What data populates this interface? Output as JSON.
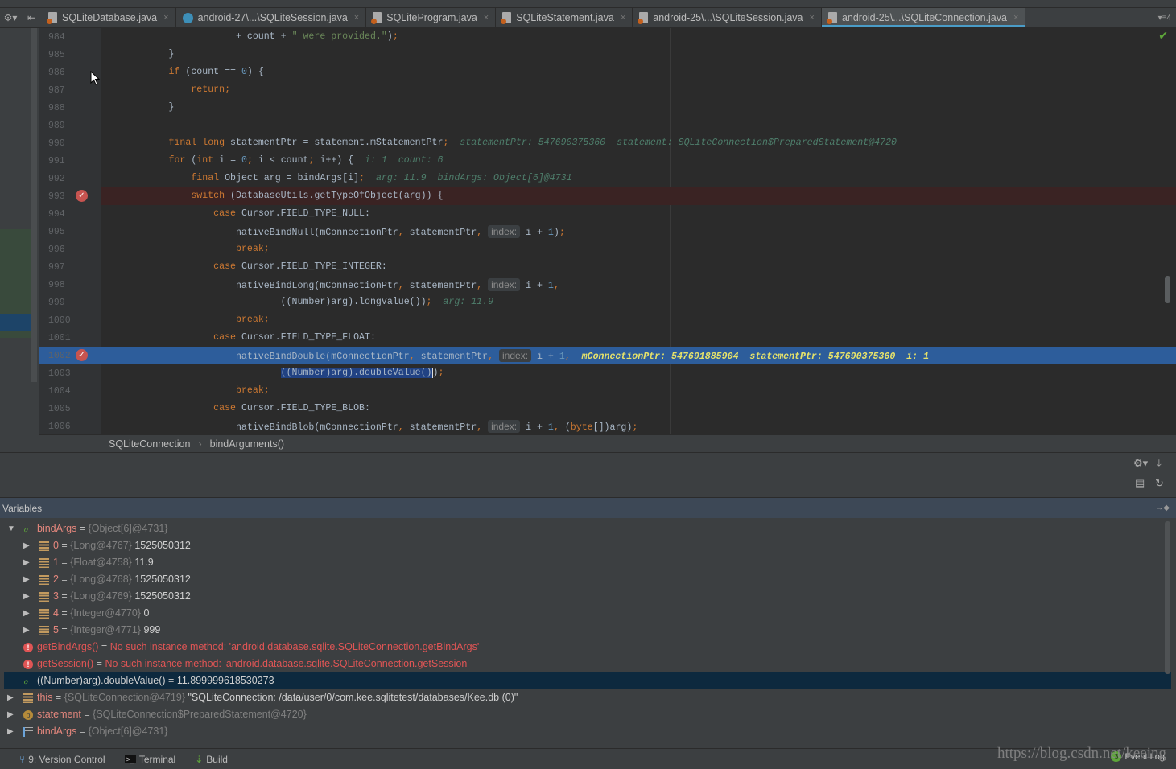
{
  "tabs": [
    {
      "label": "SQLiteDatabase.java",
      "icon": "java-file-icon",
      "active": false
    },
    {
      "label": "android-27\\...\\SQLiteSession.java",
      "icon": "class-icon",
      "active": false
    },
    {
      "label": "SQLiteProgram.java",
      "icon": "java-file-icon",
      "active": false
    },
    {
      "label": "SQLiteStatement.java",
      "icon": "java-file-icon",
      "active": false
    },
    {
      "label": "android-25\\...\\SQLiteSession.java",
      "icon": "java-file-icon",
      "active": false
    },
    {
      "label": "android-25\\...\\SQLiteConnection.java",
      "icon": "java-file-icon",
      "active": true
    }
  ],
  "tab_overflow": "▾≡4",
  "editor": {
    "lines": [
      {
        "n": "984",
        "t": [
          [
            "pl",
            "                        + count + "
          ],
          [
            "str",
            "\" were provided.\""
          ],
          [
            "pl",
            ")"
          ],
          [
            "kw",
            ";"
          ]
        ]
      },
      {
        "n": "985",
        "t": [
          [
            "pl",
            "            }"
          ]
        ]
      },
      {
        "n": "986",
        "t": [
          [
            "pl",
            "            "
          ],
          [
            "kw",
            "if "
          ],
          [
            "pl",
            "(count == "
          ],
          [
            "num",
            "0"
          ],
          [
            "pl",
            ") {"
          ]
        ]
      },
      {
        "n": "987",
        "t": [
          [
            "pl",
            "                "
          ],
          [
            "kw",
            "return;"
          ]
        ]
      },
      {
        "n": "988",
        "t": [
          [
            "pl",
            "            }"
          ]
        ]
      },
      {
        "n": "989",
        "t": []
      },
      {
        "n": "990",
        "t": [
          [
            "pl",
            "            "
          ],
          [
            "kw",
            "final long "
          ],
          [
            "pl",
            "statementPtr = statement.mStatementPtr"
          ],
          [
            "kw",
            ";"
          ],
          [
            "dbg",
            "  statementPtr: 547690375360  statement: SQLiteConnection$PreparedStatement@4720"
          ]
        ]
      },
      {
        "n": "991",
        "t": [
          [
            "pl",
            "            "
          ],
          [
            "kw",
            "for "
          ],
          [
            "pl",
            "("
          ],
          [
            "kw",
            "int "
          ],
          [
            "pl",
            "i = "
          ],
          [
            "num",
            "0"
          ],
          [
            "kw",
            "; "
          ],
          [
            "pl",
            "i < count"
          ],
          [
            "kw",
            "; "
          ],
          [
            "pl",
            "i++) {  "
          ],
          [
            "dbg",
            "i: 1  count: 6"
          ]
        ]
      },
      {
        "n": "992",
        "t": [
          [
            "pl",
            "                "
          ],
          [
            "kw",
            "final "
          ],
          [
            "pl",
            "Object arg = bindArgs[i]"
          ],
          [
            "kw",
            ";"
          ],
          [
            "dbg",
            "  arg: 11.9  bindArgs: Object[6]@4731"
          ]
        ]
      },
      {
        "n": "993",
        "bp": true,
        "t": [
          [
            "pl",
            "                "
          ],
          [
            "kw",
            "switch "
          ],
          [
            "pl",
            "(DatabaseUtils.getTypeOfObject(arg)) {"
          ]
        ]
      },
      {
        "n": "994",
        "t": [
          [
            "pl",
            "                    "
          ],
          [
            "kw",
            "case "
          ],
          [
            "pl",
            "Cursor.FIELD_TYPE_NULL:"
          ]
        ]
      },
      {
        "n": "995",
        "t": [
          [
            "pl",
            "                        nativeBindNull(mConnectionPtr"
          ],
          [
            "kw",
            ", "
          ],
          [
            "pl",
            "statementPtr"
          ],
          [
            "kw",
            ", "
          ],
          [
            "hint",
            "index:"
          ],
          [
            "pl",
            " i + "
          ],
          [
            "num",
            "1"
          ],
          [
            "pl",
            ")"
          ],
          [
            "kw",
            ";"
          ]
        ]
      },
      {
        "n": "996",
        "t": [
          [
            "pl",
            "                        "
          ],
          [
            "kw",
            "break;"
          ]
        ]
      },
      {
        "n": "997",
        "t": [
          [
            "pl",
            "                    "
          ],
          [
            "kw",
            "case "
          ],
          [
            "pl",
            "Cursor.FIELD_TYPE_INTEGER:"
          ]
        ]
      },
      {
        "n": "998",
        "t": [
          [
            "pl",
            "                        nativeBindLong(mConnectionPtr"
          ],
          [
            "kw",
            ", "
          ],
          [
            "pl",
            "statementPtr"
          ],
          [
            "kw",
            ", "
          ],
          [
            "hint",
            "index:"
          ],
          [
            "pl",
            " i + "
          ],
          [
            "num",
            "1"
          ],
          [
            "kw",
            ","
          ]
        ]
      },
      {
        "n": "999",
        "t": [
          [
            "pl",
            "                                ((Number)arg).longValue())"
          ],
          [
            "kw",
            ";"
          ],
          [
            "dbg",
            "  arg: 11.9"
          ]
        ]
      },
      {
        "n": "1000",
        "t": [
          [
            "pl",
            "                        "
          ],
          [
            "kw",
            "break;"
          ]
        ]
      },
      {
        "n": "1001",
        "t": [
          [
            "pl",
            "                    "
          ],
          [
            "kw",
            "case "
          ],
          [
            "pl",
            "Cursor.FIELD_TYPE_FLOAT:"
          ]
        ]
      },
      {
        "n": "1002",
        "bp": true,
        "cur": true,
        "t": [
          [
            "pl",
            "                        nativeBindDouble(mConnectionPtr"
          ],
          [
            "kw",
            ", "
          ],
          [
            "pl",
            "statementPtr"
          ],
          [
            "kw",
            ", "
          ],
          [
            "hint",
            "index:"
          ],
          [
            "pl",
            " i + "
          ],
          [
            "num",
            "1"
          ],
          [
            "kw",
            ","
          ],
          [
            "dbgy",
            "  mConnectionPtr: 547691885904  statementPtr: 547690375360  i: 1"
          ]
        ]
      },
      {
        "n": "1003",
        "t": [
          [
            "pl",
            "                                "
          ],
          [
            "sel",
            "((Number)arg).doubleValue()"
          ],
          [
            "caret",
            ")"
          ],
          [
            "kw",
            ";"
          ]
        ]
      },
      {
        "n": "1004",
        "t": [
          [
            "pl",
            "                        "
          ],
          [
            "kw",
            "break;"
          ]
        ]
      },
      {
        "n": "1005",
        "t": [
          [
            "pl",
            "                    "
          ],
          [
            "kw",
            "case "
          ],
          [
            "pl",
            "Cursor.FIELD_TYPE_BLOB:"
          ]
        ]
      },
      {
        "n": "1006",
        "t": [
          [
            "pl",
            "                        nativeBindBlob(mConnectionPtr"
          ],
          [
            "kw",
            ", "
          ],
          [
            "pl",
            "statementPtr"
          ],
          [
            "kw",
            ", "
          ],
          [
            "hint",
            "index:"
          ],
          [
            "pl",
            " i + "
          ],
          [
            "num",
            "1"
          ],
          [
            "kw",
            ", "
          ],
          [
            "pl",
            "("
          ],
          [
            "kw",
            "byte"
          ],
          [
            "pl",
            "[])arg)"
          ],
          [
            "kw",
            ";"
          ]
        ]
      }
    ]
  },
  "breadcrumb": {
    "class": "SQLiteConnection",
    "method": "bindArguments()"
  },
  "variables": {
    "title": "Variables",
    "pin": "→◆",
    "rows": [
      {
        "indent": 0,
        "arrow": "down",
        "icon": "watch",
        "name": "bindArgs",
        "type": "{Object[6]@4731}",
        "value": ""
      },
      {
        "indent": 1,
        "arrow": "right",
        "icon": "field",
        "name": "0",
        "type": "{Long@4767}",
        "value": "1525050312"
      },
      {
        "indent": 1,
        "arrow": "right",
        "icon": "field",
        "name": "1",
        "type": "{Float@4758}",
        "value": "11.9"
      },
      {
        "indent": 1,
        "arrow": "right",
        "icon": "field",
        "name": "2",
        "type": "{Long@4768}",
        "value": "1525050312"
      },
      {
        "indent": 1,
        "arrow": "right",
        "icon": "field",
        "name": "3",
        "type": "{Long@4769}",
        "value": "1525050312"
      },
      {
        "indent": 1,
        "arrow": "right",
        "icon": "field",
        "name": "4",
        "type": "{Integer@4770}",
        "value": "0"
      },
      {
        "indent": 1,
        "arrow": "right",
        "icon": "field",
        "name": "5",
        "type": "{Integer@4771}",
        "value": "999"
      },
      {
        "indent": 0,
        "arrow": "",
        "icon": "error",
        "name": "getBindArgs()",
        "type": "",
        "value": "",
        "error": "No such instance method: 'android.database.sqlite.SQLiteConnection.getBindArgs'"
      },
      {
        "indent": 0,
        "arrow": "",
        "icon": "error",
        "name": "getSession()",
        "type": "",
        "value": "",
        "error": "No such instance method: 'android.database.sqlite.SQLiteConnection.getSession'"
      },
      {
        "indent": 0,
        "arrow": "",
        "icon": "watch",
        "name": "((Number)arg).doubleValue()",
        "type": "",
        "value": "11.899999618530273",
        "selected": true
      },
      {
        "indent": -1,
        "arrow": "right",
        "icon": "field",
        "name": "this",
        "type": "{SQLiteConnection@4719}",
        "value": "\"SQLiteConnection: /data/user/0/com.kee.sqlitetest/databases/Kee.db (0)\""
      },
      {
        "indent": -1,
        "arrow": "right",
        "icon": "param",
        "name": "statement",
        "type": "{SQLiteConnection$PreparedStatement@4720}",
        "value": ""
      },
      {
        "indent": -1,
        "arrow": "right",
        "icon": "array",
        "name": "bindArgs",
        "type": "{Object[6]@4731}",
        "value": ""
      }
    ]
  },
  "statusbar": {
    "version_control": "9: Version Control",
    "terminal": "Terminal",
    "build": "Build",
    "event_log": "Event Log",
    "event_count": "3"
  },
  "watermark": "https://blog.csdn.net/keeing",
  "colors": {
    "keyword": "#cc7832",
    "number": "#6897bb",
    "string": "#6a8759",
    "current_line": "#2d5d9b",
    "breakpoint": "#c75450",
    "accent": "#4a9cc7"
  }
}
